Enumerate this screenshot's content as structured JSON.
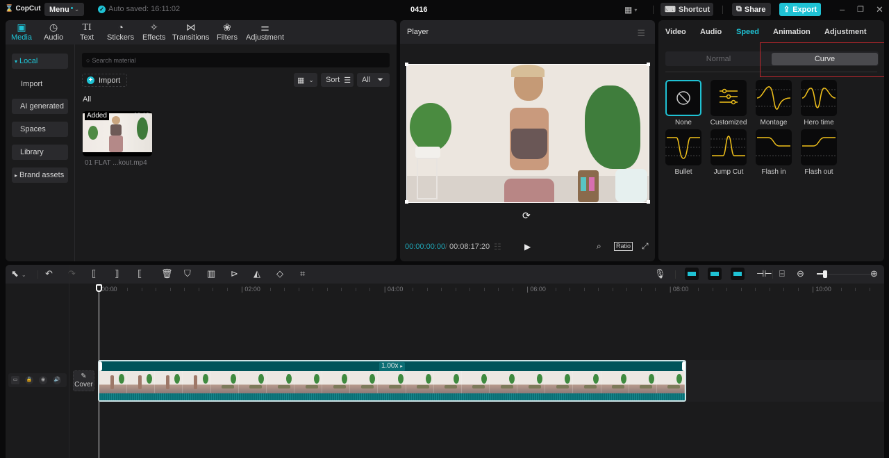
{
  "app": {
    "logo": "CopCut",
    "menu_label": "Menu",
    "autosave": "Auto saved: 16:11:02",
    "project_title": "0416",
    "shortcut_label": "Shortcut",
    "share_label": "Share",
    "export_label": "Export",
    "accent_color": "#1fc2d4"
  },
  "media": {
    "tabs": [
      {
        "label": "Media",
        "icon": "media-icon",
        "active": true
      },
      {
        "label": "Audio",
        "icon": "audio-icon"
      },
      {
        "label": "Text",
        "icon": "text-icon"
      },
      {
        "label": "Stickers",
        "icon": "stickers-icon"
      },
      {
        "label": "Effects",
        "icon": "effects-icon"
      },
      {
        "label": "Transitions",
        "icon": "transitions-icon"
      },
      {
        "label": "Filters",
        "icon": "filters-icon"
      },
      {
        "label": "Adjustment",
        "icon": "adjustment-icon"
      }
    ],
    "sidebar": [
      {
        "label": "Local",
        "active": true,
        "caret": "▾"
      },
      {
        "label": "Import"
      },
      {
        "label": "AI generated"
      },
      {
        "label": "Spaces"
      },
      {
        "label": "Library"
      },
      {
        "label": "Brand assets",
        "caret": "▸"
      }
    ],
    "search_placeholder": "Search material",
    "import_label": "Import",
    "sort_label": "Sort",
    "filter_label": "All",
    "section_label": "All",
    "items": [
      {
        "badge": "Added",
        "duration": "08:18",
        "name": "01 FLAT ...kout.mp4"
      }
    ]
  },
  "player": {
    "title": "Player",
    "current_time": "00:00:00:00",
    "total_time": "00:08:17:20",
    "ratio_label": "Ratio"
  },
  "properties": {
    "tabs": [
      {
        "label": "Video"
      },
      {
        "label": "Audio"
      },
      {
        "label": "Speed",
        "active": true
      },
      {
        "label": "Animation"
      },
      {
        "label": "Adjustment"
      }
    ],
    "mode_normal": "Normal",
    "mode_curve": "Curve",
    "active_mode": "Curve",
    "presets": [
      {
        "label": "None",
        "selected": true
      },
      {
        "label": "Customized"
      },
      {
        "label": "Montage"
      },
      {
        "label": "Hero time"
      },
      {
        "label": "Bullet"
      },
      {
        "label": "Jump Cut"
      },
      {
        "label": "Flash in"
      },
      {
        "label": "Flash out"
      }
    ],
    "curve_color": "#f2c21b"
  },
  "timeline": {
    "ruler_labels": [
      "00:00",
      "02:00",
      "04:00",
      "06:00",
      "08:00",
      "10:00"
    ],
    "cover_label": "Cover",
    "clip_speed": "1.00x",
    "zoom_level": 0.15
  }
}
